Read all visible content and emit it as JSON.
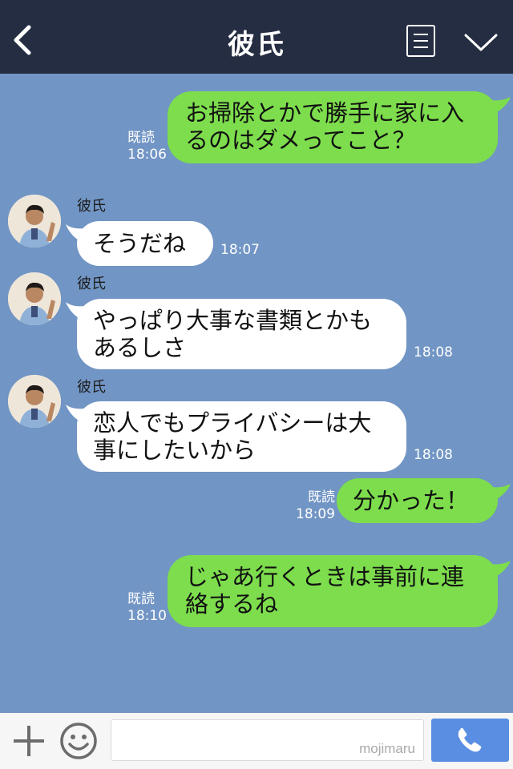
{
  "header": {
    "title": "彼氏",
    "back_icon": "chevron-left-icon",
    "menu_icon": "menu-icon",
    "collapse_icon": "chevron-down-icon"
  },
  "colors": {
    "header_bg": "#252d42",
    "chat_bg": "#7195c4",
    "sent_bubble": "#7ddd4d",
    "received_bubble": "#ffffff",
    "call_button": "#5a8ee2"
  },
  "messages": [
    {
      "direction": "sent",
      "lines": [
        "お掃除とかで勝手に家に入",
        "るのはダメってこと？"
      ],
      "read": "既読",
      "time": "18:06"
    },
    {
      "direction": "received",
      "sender": "彼氏",
      "lines": [
        "そうだね"
      ],
      "time": "18:07"
    },
    {
      "direction": "received",
      "sender": "彼氏",
      "lines": [
        "やっぱり大事な書類とかも",
        "あるしさ"
      ],
      "time": "18:08"
    },
    {
      "direction": "received",
      "sender": "彼氏",
      "lines": [
        "恋人でもプライバシーは大",
        "事にしたいから"
      ],
      "time": "18:08"
    },
    {
      "direction": "sent",
      "lines": [
        "分かった！"
      ],
      "read": "既読",
      "time": "18:09"
    },
    {
      "direction": "sent",
      "lines": [
        "じゃあ行くときは事前に連",
        "絡するね"
      ],
      "read": "既読",
      "time": "18:10"
    }
  ],
  "footer": {
    "plus_icon": "plus-icon",
    "emoji_icon": "emoji-icon",
    "input_value": "",
    "watermark": "mojimaru",
    "call_icon": "phone-icon"
  }
}
